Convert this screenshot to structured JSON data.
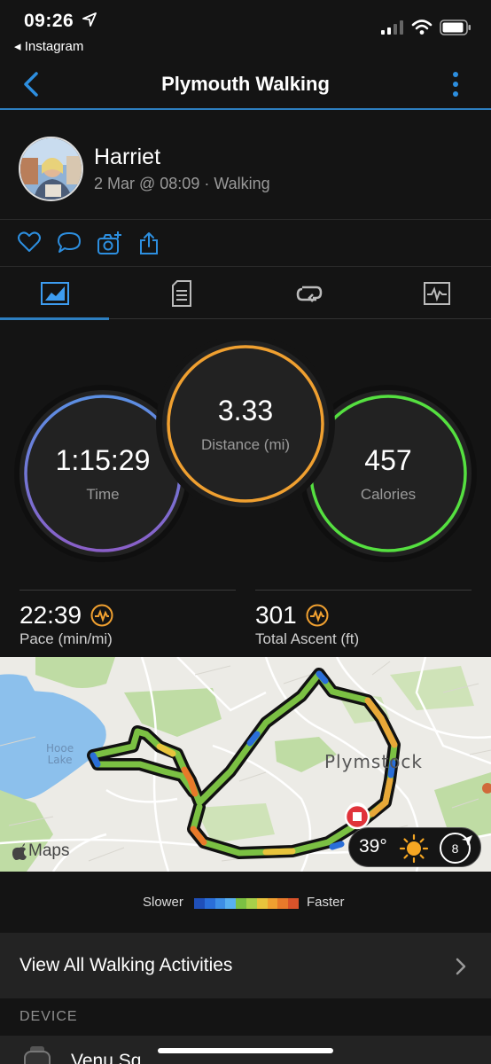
{
  "status": {
    "time": "09:26",
    "back_app": "◂ Instagram"
  },
  "nav": {
    "title": "Plymouth Walking"
  },
  "profile": {
    "name": "Harriet",
    "meta": "2 Mar @ 08:09 · Walking"
  },
  "rings": {
    "time": {
      "value": "1:15:29",
      "label": "Time"
    },
    "distance": {
      "value": "3.33",
      "label": "Distance (mi)"
    },
    "calories": {
      "value": "457",
      "label": "Calories"
    }
  },
  "stats": {
    "pace": {
      "value": "22:39",
      "label": "Pace (min/mi)"
    },
    "ascent": {
      "value": "301",
      "label": "Total Ascent (ft)"
    }
  },
  "map": {
    "lake_label": [
      "Hooe",
      "Lake"
    ],
    "town_label": "Plymstock",
    "maps_brand": "Maps",
    "weather_temp": "39°",
    "wind_speed": "8"
  },
  "legend": {
    "slower": "Slower",
    "faster": "Faster",
    "colors": [
      "#1f4fb8",
      "#2a6ed8",
      "#3d8ee6",
      "#58b0f0",
      "#7bc043",
      "#a8d04a",
      "#e8c43c",
      "#f0a030",
      "#e87a2a",
      "#d9532a"
    ]
  },
  "view_all": {
    "label": "View All Walking Activities"
  },
  "device": {
    "section": "DEVICE",
    "name": "Venu Sq"
  },
  "colors": {
    "accent": "#2d7fc1",
    "time_ring": "#6a8fe0",
    "distance_ring": "#f0a030",
    "calories_ring": "#55e040"
  }
}
